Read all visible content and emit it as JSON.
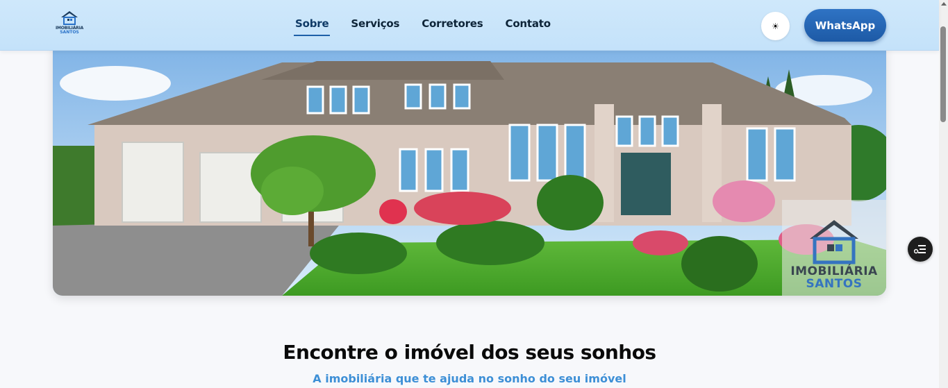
{
  "brand": {
    "line1": "IMOBILIÁRIA",
    "line2": "SANTOS"
  },
  "nav": {
    "items": [
      {
        "label": "Sobre"
      },
      {
        "label": "Serviços"
      },
      {
        "label": "Corretores"
      },
      {
        "label": "Contato"
      }
    ]
  },
  "header": {
    "theme_icon": "☀",
    "whatsapp_label": "WhatsApp"
  },
  "hero": {
    "watermark_line1": "IMOBILIÁRIA",
    "watermark_line2": "SANTOS"
  },
  "main": {
    "headline": "Encontre o imóvel dos seus sonhos",
    "subline": "A imobiliária que te ajuda no sonho do seu imóvel"
  },
  "colors": {
    "accent": "#1d5fa8",
    "header_bg": "#c4e2fa",
    "subline": "#3d8fd6"
  }
}
